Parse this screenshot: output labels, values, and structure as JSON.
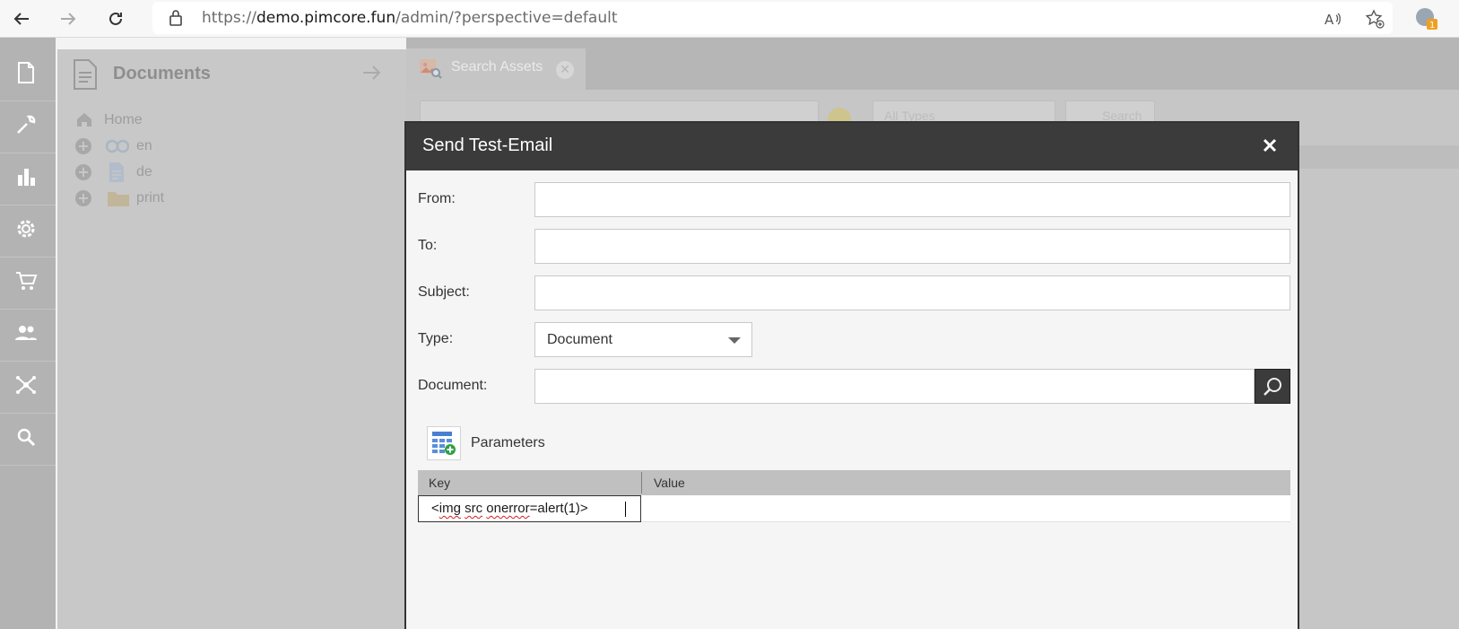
{
  "browser": {
    "url_scheme": "https://",
    "url_host": "demo.pimcore.fun",
    "url_path": "/admin/?perspective=default",
    "badge_count": "1"
  },
  "tree": {
    "title": "Documents",
    "items": [
      {
        "label": "Home"
      },
      {
        "label": "en"
      },
      {
        "label": "de"
      },
      {
        "label": "print"
      }
    ]
  },
  "tab": {
    "label": "Search Assets"
  },
  "background": {
    "type_filter": "All Types",
    "search_label": "Search"
  },
  "modal": {
    "title": "Send Test-Email",
    "fields": {
      "from_label": "From:",
      "to_label": "To:",
      "subject_label": "Subject:",
      "type_label": "Type:",
      "type_value": "Document",
      "document_label": "Document:"
    },
    "parameters": {
      "label": "Parameters",
      "col_key": "Key",
      "col_value": "Value",
      "row_key_prefix": "<",
      "row_key_w1": "img",
      "row_key_w2": "src",
      "row_key_w3": "onerror",
      "row_key_suffix": "=alert(1)>"
    }
  },
  "colors": {
    "modal_header": "#3b3b3b",
    "mask": "#c6c6c6",
    "accent_green": "#2ea043"
  }
}
